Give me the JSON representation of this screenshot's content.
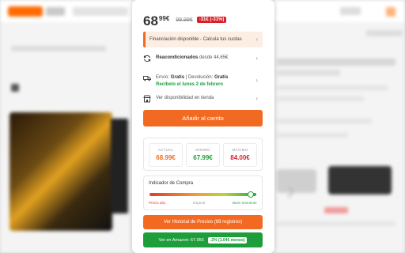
{
  "price": {
    "main": "68",
    "cents": "99€",
    "old": "99.99€",
    "discount": "-31€ (-31%)"
  },
  "finance": {
    "text": "Financiación disponible - Calcula tus cuotas"
  },
  "refurb": {
    "label": "Reacondicionados",
    "suffix": " desde 44,65€"
  },
  "shipping": {
    "envio_label": "Envío: ",
    "envio_value": "Gratis",
    "sep": " | ",
    "devol_label": "Devolución: ",
    "devol_value": "Gratis",
    "delivery": "Recíbelo el lunes 2 de febrero"
  },
  "store": {
    "label": "Ver disponibilidad en tienda"
  },
  "cart_button": "Añadir al carrito",
  "stats": [
    {
      "label": "ACTUAL",
      "value": "68.99€",
      "color": "#f26a21"
    },
    {
      "label": "MÍNIMO",
      "value": "67.99€",
      "color": "#1e9e3b"
    },
    {
      "label": "MÁXIMO",
      "value": "84.00€",
      "color": "#d81f26"
    }
  ],
  "indicator": {
    "title": "Indicador de Compra",
    "level": 0.95,
    "labels": {
      "high": "Precio alto",
      "mid": "Esperar",
      "good": "Buen momento"
    }
  },
  "history_button": "Ver Historial de Precios (89 registros)",
  "amazon": {
    "label": "Ver en Amazon: 67.95€",
    "badge": "-2% (1.04€ menos)"
  },
  "colors": {
    "accent": "#f26a21",
    "green": "#1e9e3b",
    "red": "#d81f26"
  }
}
